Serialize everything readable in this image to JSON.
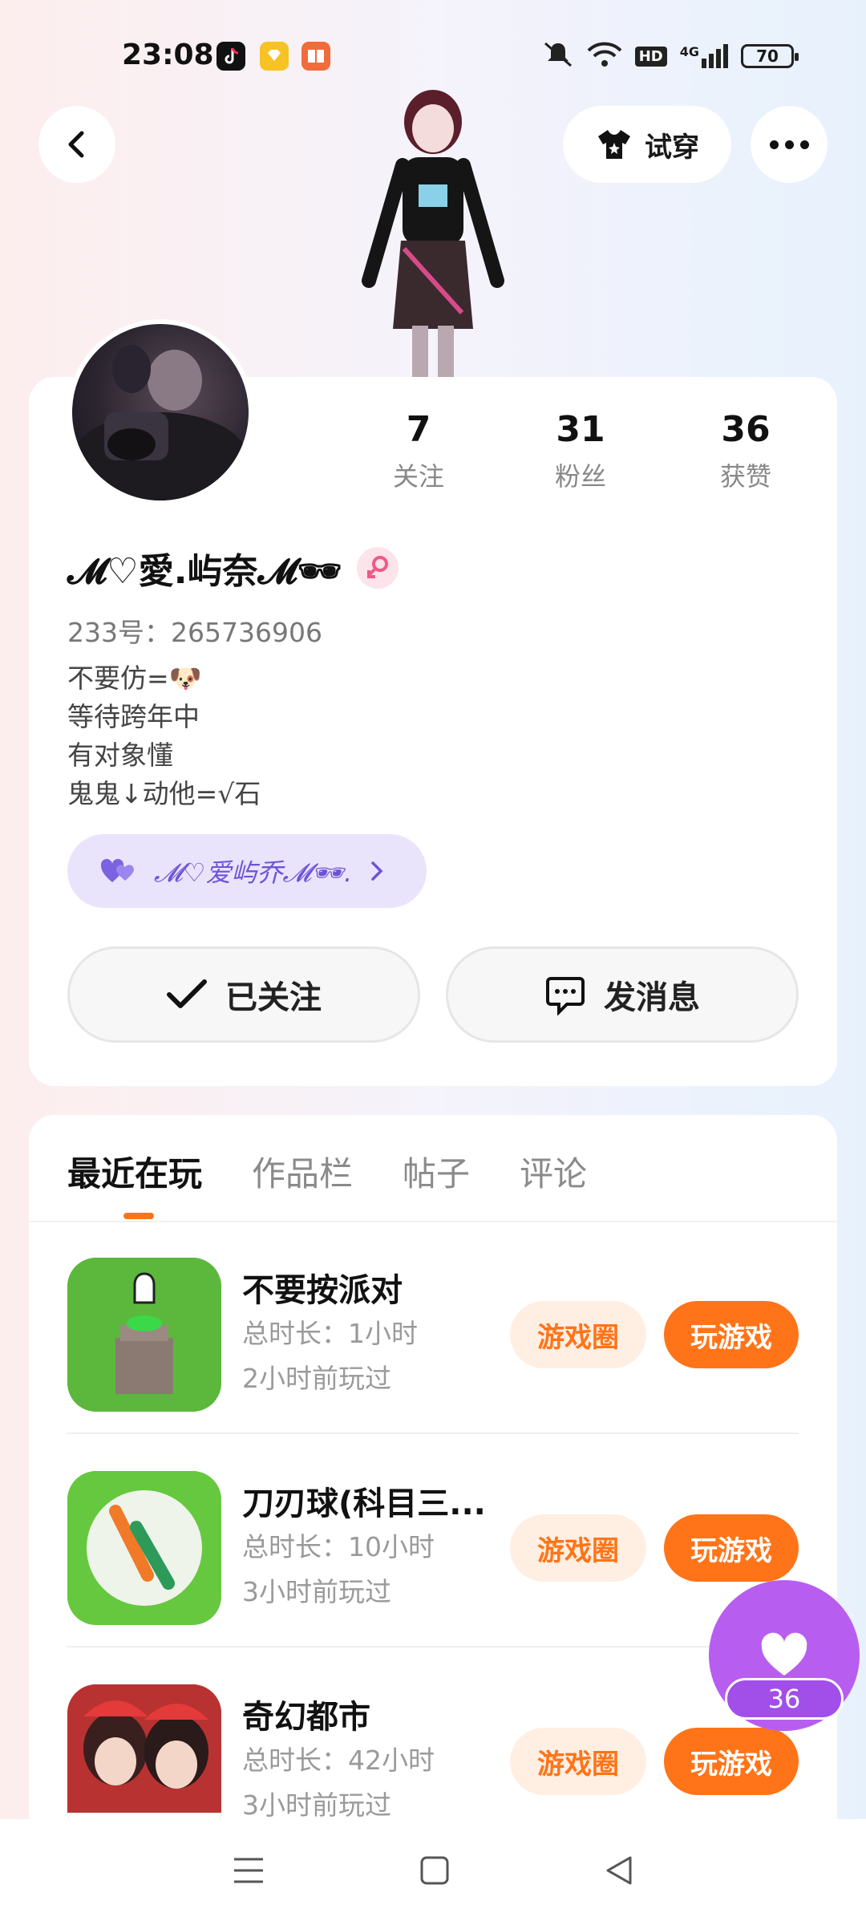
{
  "status_bar": {
    "time": "23:08",
    "battery": "70",
    "network": "4G",
    "hd_label": "HD",
    "icons": [
      "tiktok-icon",
      "coin-app-icon",
      "book-app-icon",
      "mute-icon",
      "wifi-icon",
      "hd-icon",
      "signal-icon"
    ]
  },
  "header": {
    "try_on_label": "试穿"
  },
  "profile": {
    "name": "𝓜♡愛.屿奈𝓜🕶",
    "uid": "233号：265736906",
    "bio": [
      "不要仿=🐶",
      "等待跨年中",
      "有对象懂",
      "鬼鬼↓动他=√石"
    ],
    "badge_text": "𝓜♡爱屿乔𝓜🕶.",
    "stats": [
      {
        "value": "7",
        "label": "关注"
      },
      {
        "value": "31",
        "label": "粉丝"
      },
      {
        "value": "36",
        "label": "获赞"
      }
    ],
    "follow_label": "已关注",
    "message_label": "发消息"
  },
  "tabs": [
    "最近在玩",
    "作品栏",
    "帖子",
    "评论"
  ],
  "games": [
    {
      "title": "不要按派对",
      "duration": "总时长：1小时",
      "last_played": "2小时前玩过",
      "circle_label": "游戏圈",
      "play_label": "玩游戏"
    },
    {
      "title": "刀刃球(科目三...",
      "duration": "总时长：10小时",
      "last_played": "3小时前玩过",
      "circle_label": "游戏圈",
      "play_label": "玩游戏"
    },
    {
      "title": "奇幻都市",
      "duration": "总时长：42小时",
      "last_played": "3小时前玩过",
      "circle_label": "游戏圈",
      "play_label": "玩游戏"
    }
  ],
  "like_fab": {
    "count": "36"
  },
  "colors": {
    "accent": "#ff7418",
    "like_purple": "#b75ef0",
    "badge_purple": "#6b55d6"
  }
}
